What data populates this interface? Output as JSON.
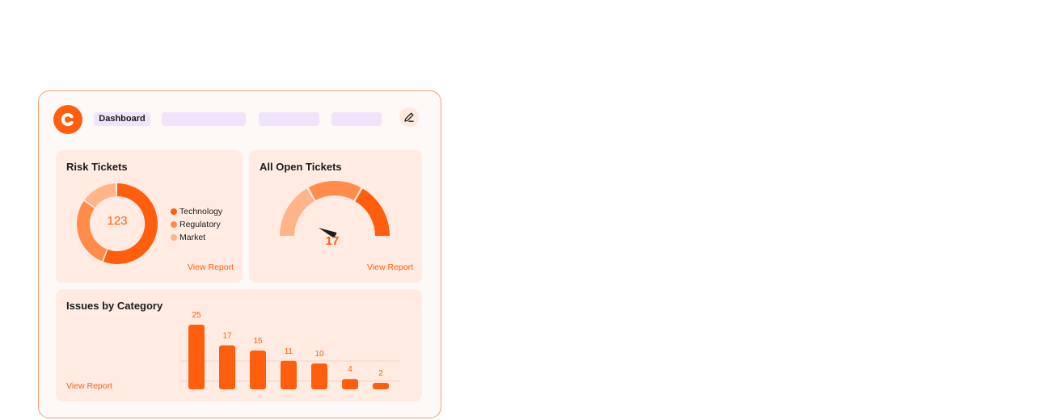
{
  "header": {
    "nav_active_label": "Dashboard",
    "logo_icon": "c-logo-icon",
    "edit_icon": "edit-pencil-icon"
  },
  "risk_tickets": {
    "title": "Risk Tickets",
    "total": "123",
    "legend": [
      {
        "label": "Technology",
        "color": "#ff5e0e"
      },
      {
        "label": "Regulatory",
        "color": "#ff8c4a"
      },
      {
        "label": "Market",
        "color": "#ffb48a"
      }
    ],
    "view_report": "View Report"
  },
  "open_tickets": {
    "title": "All Open Tickets",
    "value": "17",
    "view_report": "View Report"
  },
  "issues": {
    "title": "Issues by Category",
    "view_report": "View Report"
  },
  "chart_data": {
    "type": "bar",
    "categories": [
      "",
      "",
      "",
      "",
      "",
      "",
      ""
    ],
    "values": [
      25,
      17,
      15,
      11,
      10,
      4,
      2
    ],
    "title": "Issues by Category",
    "xlabel": "",
    "ylabel": "",
    "grid": true,
    "bar_color": "#ff5e0e"
  },
  "colors": {
    "accent": "#ff5e0e",
    "card_bg": "#ffebe2",
    "nav_pill": "#efe4fb"
  }
}
